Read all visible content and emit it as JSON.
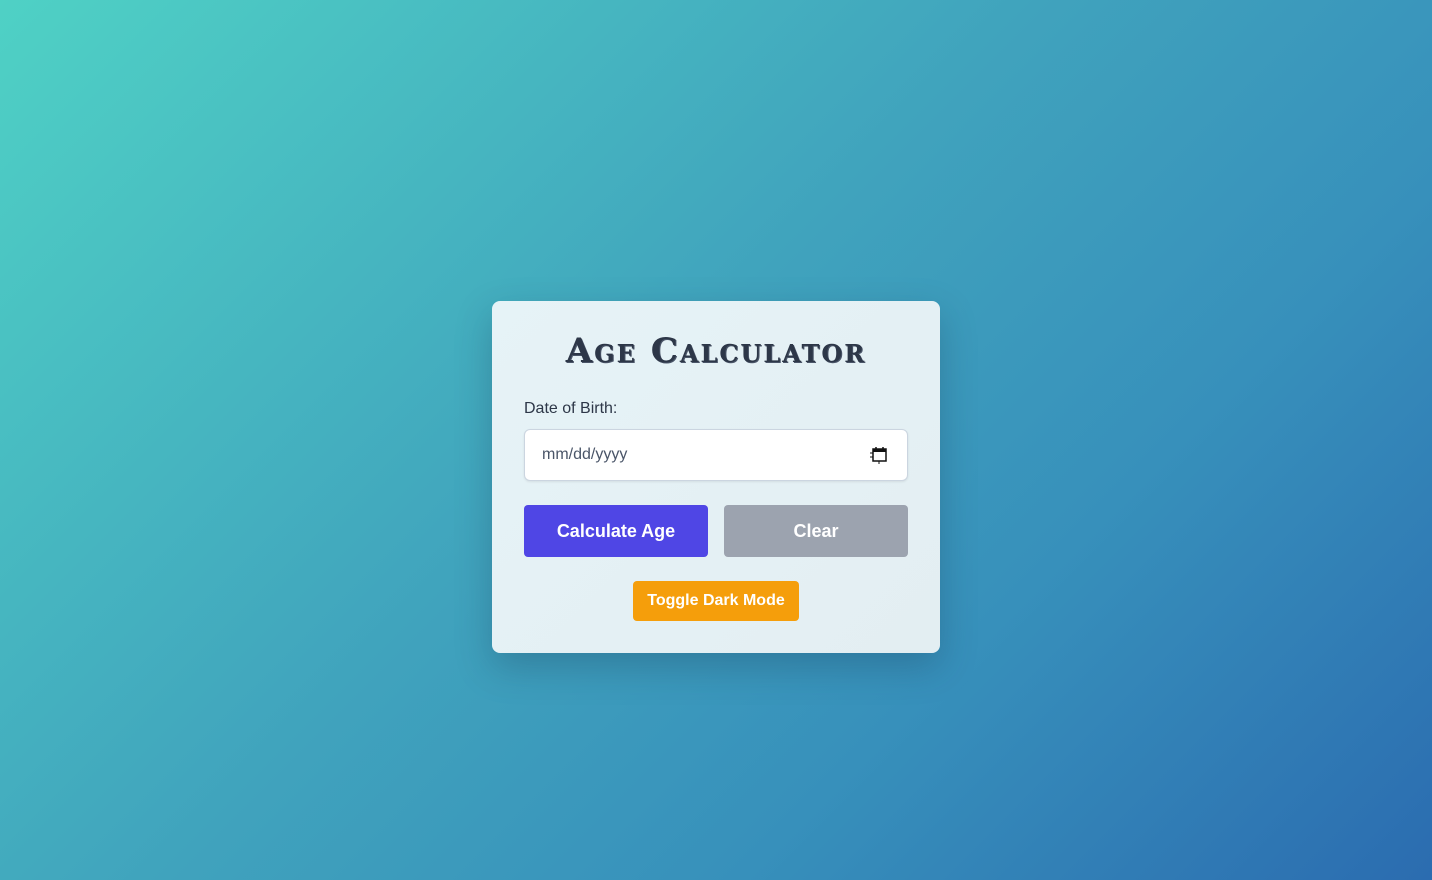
{
  "app": {
    "title": "Age Calculator"
  },
  "form": {
    "dob_label": "Date of Birth:",
    "dob_placeholder": "mm/dd/yyyy",
    "dob_value": ""
  },
  "buttons": {
    "calculate_label": "Calculate Age",
    "clear_label": "Clear",
    "toggle_label": "Toggle Dark Mode"
  },
  "icons": {
    "date_picker": "calendar-icon"
  },
  "colors": {
    "primary": "#4f46e5",
    "secondary": "#9ca3af",
    "accent": "#f59e0b",
    "text": "#2d3748"
  }
}
